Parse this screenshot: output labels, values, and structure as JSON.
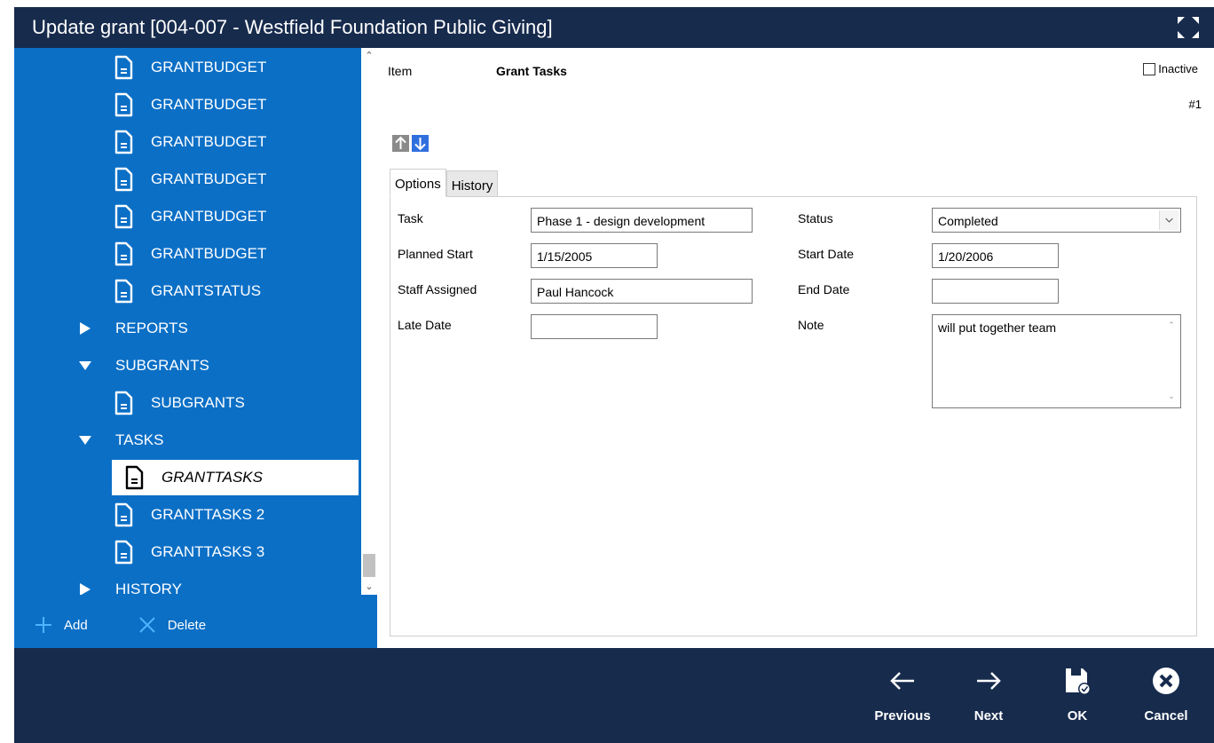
{
  "window": {
    "title": "Update grant [004-007 - Westfield Foundation Public Giving]"
  },
  "tree": {
    "items": [
      {
        "label": "GRANTBUDGET",
        "kind": "doc",
        "level": 2,
        "selected": false
      },
      {
        "label": "GRANTBUDGET",
        "kind": "doc",
        "level": 2,
        "selected": false
      },
      {
        "label": "GRANTBUDGET",
        "kind": "doc",
        "level": 2,
        "selected": false
      },
      {
        "label": "GRANTBUDGET",
        "kind": "doc",
        "level": 2,
        "selected": false
      },
      {
        "label": "GRANTBUDGET",
        "kind": "doc",
        "level": 2,
        "selected": false
      },
      {
        "label": "GRANTBUDGET",
        "kind": "doc",
        "level": 2,
        "selected": false
      },
      {
        "label": "GRANTSTATUS",
        "kind": "doc",
        "level": 2,
        "selected": false
      },
      {
        "label": "REPORTS",
        "kind": "folder-collapsed",
        "level": 1,
        "selected": false
      },
      {
        "label": "SUBGRANTS",
        "kind": "folder-expanded",
        "level": 1,
        "selected": false
      },
      {
        "label": "SUBGRANTS",
        "kind": "doc",
        "level": 2,
        "selected": false
      },
      {
        "label": "TASKS",
        "kind": "folder-expanded",
        "level": 1,
        "selected": false
      },
      {
        "label": "GRANTTASKS",
        "kind": "doc",
        "level": 2,
        "selected": true
      },
      {
        "label": "GRANTTASKS 2",
        "kind": "doc",
        "level": 2,
        "selected": false
      },
      {
        "label": "GRANTTASKS 3",
        "kind": "doc",
        "level": 2,
        "selected": false
      },
      {
        "label": "HISTORY",
        "kind": "folder-collapsed",
        "level": 1,
        "selected": false
      }
    ]
  },
  "sidebar_actions": {
    "add_label": "Add",
    "delete_label": "Delete"
  },
  "header": {
    "item_label": "Item",
    "item_value": "Grant Tasks",
    "inactive_label": "Inactive",
    "inactive_checked": false,
    "record_number": "#1"
  },
  "tabs": [
    {
      "label": "Options",
      "active": true
    },
    {
      "label": "History",
      "active": false
    }
  ],
  "form": {
    "task_label": "Task",
    "task_value": "Phase 1 - design development",
    "planned_start_label": "Planned Start",
    "planned_start_value": "1/15/2005",
    "staff_assigned_label": "Staff Assigned",
    "staff_assigned_value": "Paul Hancock",
    "late_date_label": "Late Date",
    "late_date_value": "",
    "status_label": "Status",
    "status_value": "Completed",
    "start_date_label": "Start Date",
    "start_date_value": "1/20/2006",
    "end_date_label": "End Date",
    "end_date_value": "",
    "note_label": "Note",
    "note_value": "will put together team"
  },
  "footer": {
    "previous_label": "Previous",
    "next_label": "Next",
    "ok_label": "OK",
    "cancel_label": "Cancel"
  },
  "colors": {
    "titlebar": "#172b4d",
    "sidebar": "#0b6fc6",
    "move_down_btn": "#2f6fde",
    "move_up_btn": "#8a8a8a"
  }
}
